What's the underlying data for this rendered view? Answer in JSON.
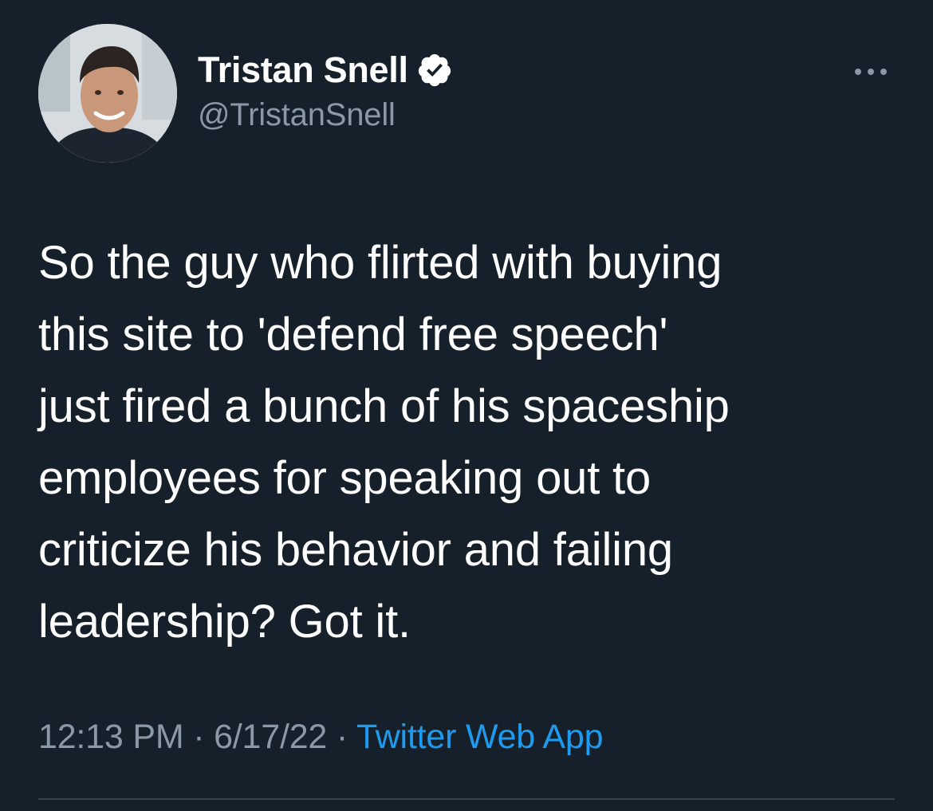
{
  "author": {
    "display_name": "Tristan Snell",
    "handle": "@TristanSnell",
    "verified": true
  },
  "tweet": {
    "text_lines": [
      "So the guy who flirted with buying",
      "this site to 'defend free speech'",
      "just fired a bunch of his spaceship",
      "employees for speaking out to",
      "criticize his behavior and failing",
      "leadership? Got it."
    ]
  },
  "meta": {
    "time": "12:13 PM",
    "separator": " · ",
    "date": "6/17/22",
    "source": "Twitter Web App"
  },
  "icons": {
    "verified": "verified-badge-icon",
    "more": "more-options-icon"
  },
  "colors": {
    "background": "#15202b",
    "text": "#ffffff",
    "secondary": "#8b98a5",
    "link": "#1d9bf0"
  }
}
